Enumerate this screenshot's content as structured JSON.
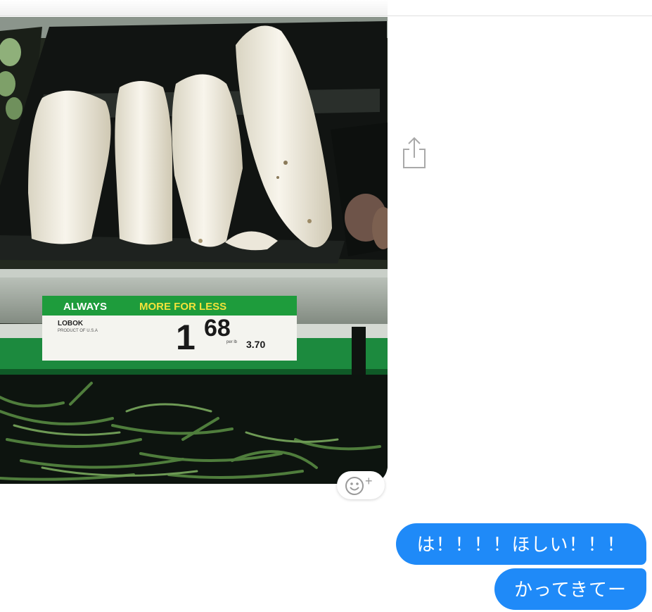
{
  "photo_message": {
    "price_tag": {
      "banner_left": "ALWAYS",
      "banner_right": "MORE FOR LESS",
      "product_name": "LOBOK",
      "product_origin": "PRODUCT OF U.S.A",
      "price_dollar": "1",
      "price_cents": "68",
      "per_unit_label": "per lb",
      "unit_price": "3.70"
    }
  },
  "reaction": {
    "plus_symbol": "+"
  },
  "messages": [
    {
      "text": "は！！！！ほしい！！！"
    },
    {
      "text": "かってきてー"
    }
  ],
  "colors": {
    "sent_bubble": "#1f8af8",
    "price_banner": "#1e9c3c",
    "price_banner_accent": "#f2e23a"
  },
  "icons": {
    "share": "share-icon",
    "reaction": "smiley-add-icon"
  }
}
